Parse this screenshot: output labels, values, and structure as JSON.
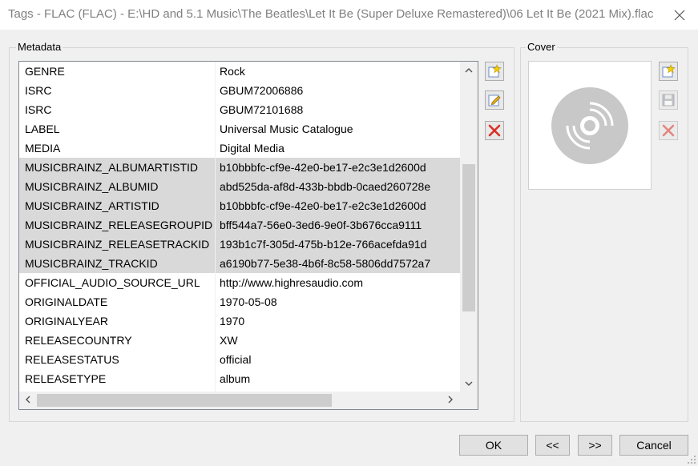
{
  "window": {
    "title": "Tags - FLAC (FLAC) - E:\\HD and 5.1 Music\\The Beatles\\Let It Be (Super Deluxe Remastered)\\06 Let It Be (2021 Mix).flac",
    "close_icon": "close-icon"
  },
  "metadata": {
    "group_label": "Metadata",
    "rows": [
      {
        "key": "GENRE",
        "value": "Rock",
        "selected": false
      },
      {
        "key": "ISRC",
        "value": "GBUM72006886",
        "selected": false
      },
      {
        "key": "ISRC",
        "value": "GBUM72101688",
        "selected": false
      },
      {
        "key": "LABEL",
        "value": "Universal Music Catalogue",
        "selected": false
      },
      {
        "key": "MEDIA",
        "value": "Digital Media",
        "selected": false
      },
      {
        "key": "MUSICBRAINZ_ALBUMARTISTID",
        "value": "b10bbbfc-cf9e-42e0-be17-e2c3e1d2600d",
        "selected": true
      },
      {
        "key": "MUSICBRAINZ_ALBUMID",
        "value": "abd525da-af8d-433b-bbdb-0caed260728e",
        "selected": true
      },
      {
        "key": "MUSICBRAINZ_ARTISTID",
        "value": "b10bbbfc-cf9e-42e0-be17-e2c3e1d2600d",
        "selected": true
      },
      {
        "key": "MUSICBRAINZ_RELEASEGROUPID",
        "value": "bff544a7-56e0-3ed6-9e0f-3b676cca9111",
        "selected": true
      },
      {
        "key": "MUSICBRAINZ_RELEASETRACKID",
        "value": "193b1c7f-305d-475b-b12e-766acefda91d",
        "selected": true
      },
      {
        "key": "MUSICBRAINZ_TRACKID",
        "value": "a6190b77-5e38-4b6f-8c58-5806dd7572a7",
        "selected": true
      },
      {
        "key": "OFFICIAL_AUDIO_SOURCE_URL",
        "value": "http://www.highresaudio.com",
        "selected": false
      },
      {
        "key": "ORIGINALDATE",
        "value": "1970-05-08",
        "selected": false
      },
      {
        "key": "ORIGINALYEAR",
        "value": "1970",
        "selected": false
      },
      {
        "key": "RELEASECOUNTRY",
        "value": "XW",
        "selected": false
      },
      {
        "key": "RELEASESTATUS",
        "value": "official",
        "selected": false
      },
      {
        "key": "RELEASETYPE",
        "value": "album",
        "selected": false
      }
    ],
    "tools": [
      {
        "name": "add-tag-button",
        "icon": "star-new-icon"
      },
      {
        "name": "edit-tag-button",
        "icon": "edit-pencil-icon"
      },
      {
        "name": "delete-tag-button",
        "icon": "delete-x-icon"
      }
    ]
  },
  "cover": {
    "group_label": "Cover",
    "placeholder_icon": "disc-icon",
    "tools": [
      {
        "name": "add-cover-button",
        "icon": "star-new-icon"
      },
      {
        "name": "save-cover-button",
        "icon": "floppy-disk-icon"
      },
      {
        "name": "delete-cover-button",
        "icon": "delete-x-icon"
      }
    ]
  },
  "buttons": {
    "ok": "OK",
    "prev": "<<",
    "next": ">>",
    "cancel": "Cancel"
  },
  "colors": {
    "selection": "#d9d9d9",
    "delete_red": "#d93025",
    "star_yellow": "#f5d000"
  }
}
